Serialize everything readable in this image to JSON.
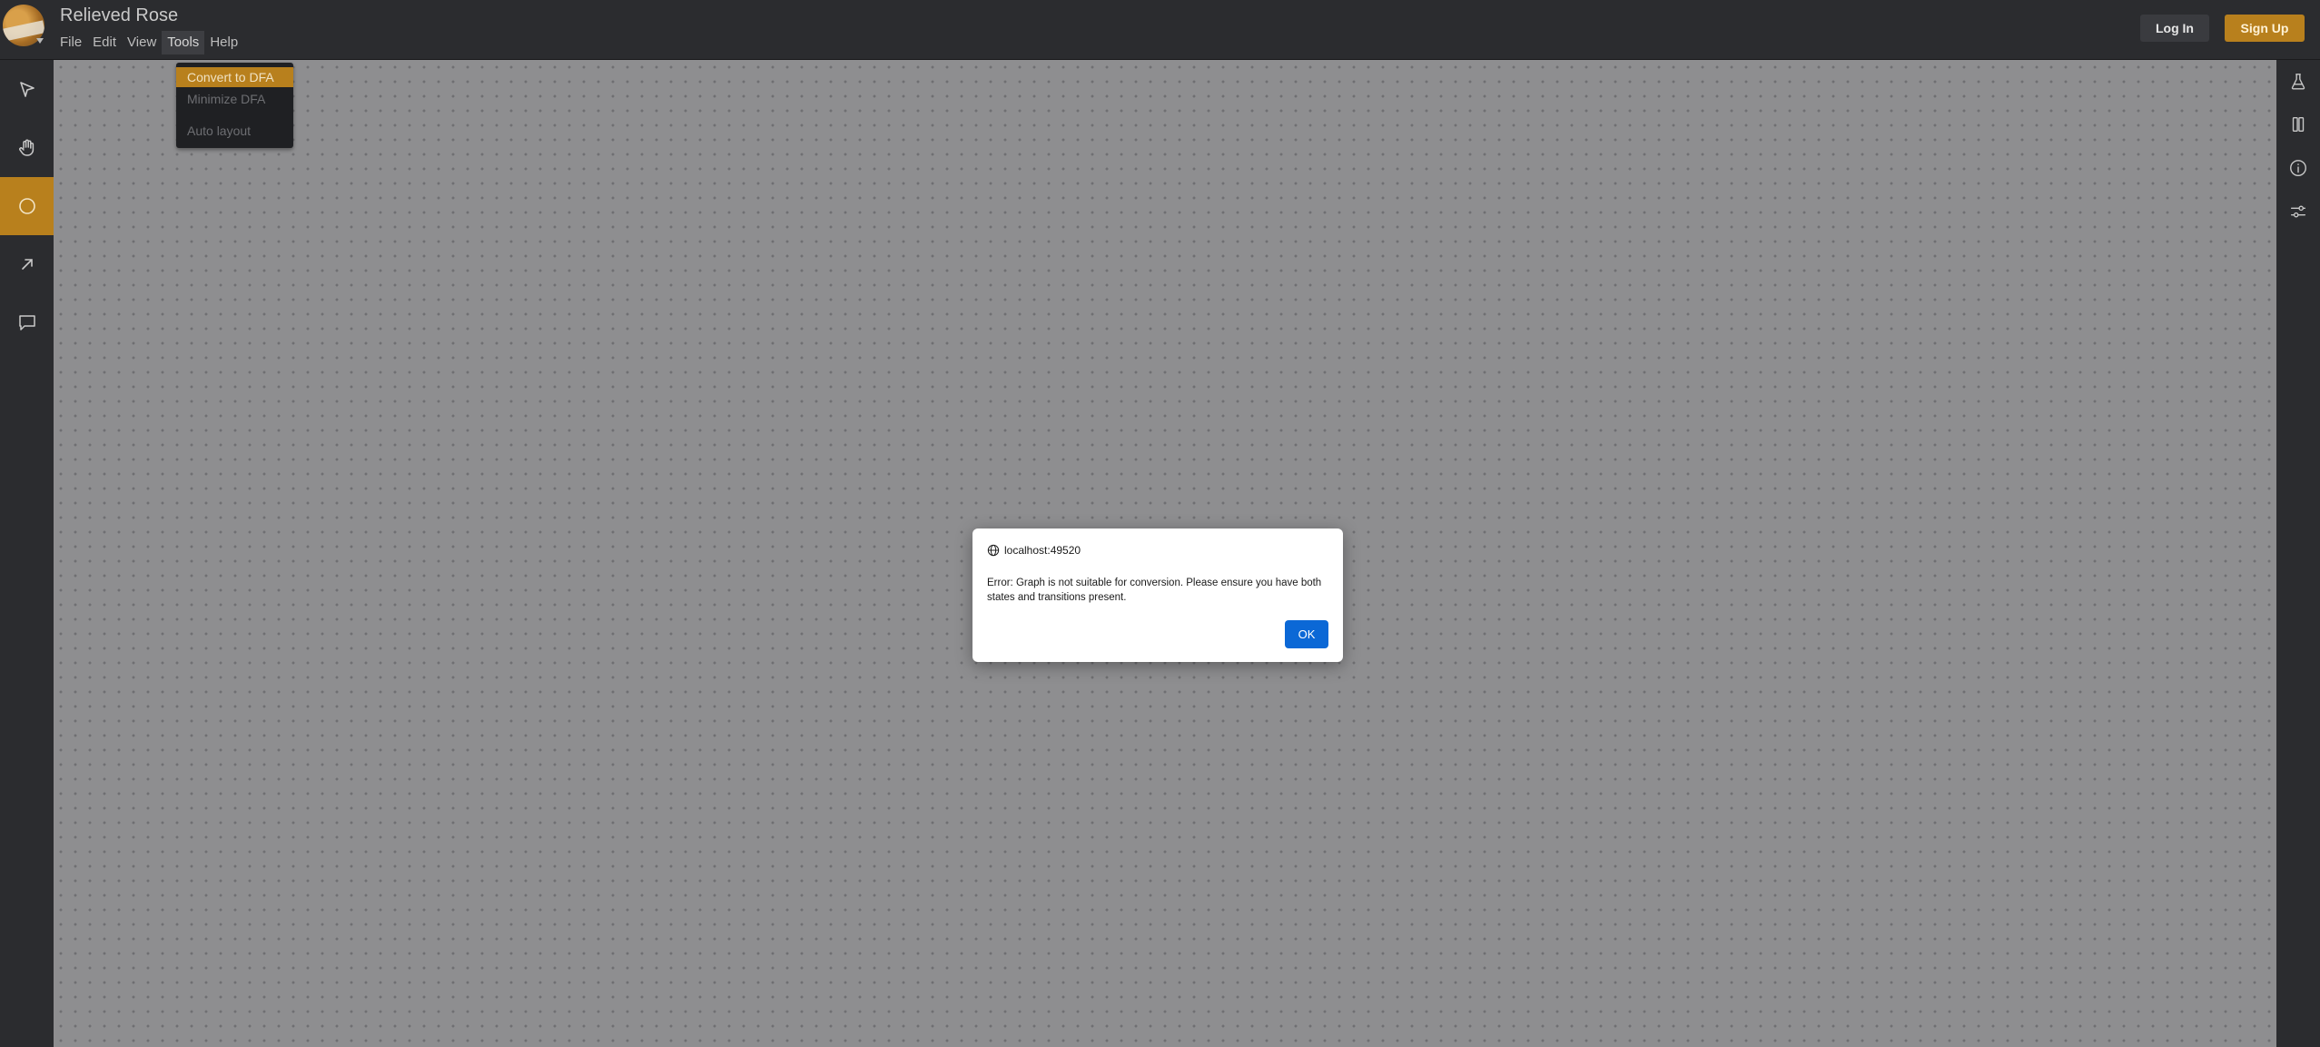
{
  "app": {
    "document_title": "Relieved Rose"
  },
  "menubar": {
    "items": [
      "File",
      "Edit",
      "View",
      "Tools",
      "Help"
    ],
    "active": "Tools"
  },
  "auth": {
    "login_label": "Log In",
    "signup_label": "Sign Up"
  },
  "left_toolbar": {
    "tools": [
      "select-pointer-icon",
      "pan-hand-icon",
      "state-circle-icon",
      "transition-arrow-icon",
      "comment-icon"
    ],
    "active": "state-circle-icon"
  },
  "right_toolbar": {
    "tools": [
      "test-flask-icon",
      "columns-icon",
      "info-icon",
      "settings-sliders-icon"
    ]
  },
  "tools_menu": {
    "items": [
      {
        "label": "Convert to DFA",
        "highlighted": true
      },
      {
        "label": "Minimize DFA",
        "highlighted": false
      },
      {
        "label": "Auto layout",
        "highlighted": false
      }
    ]
  },
  "alert": {
    "origin": "localhost:49520",
    "message": "Error: Graph is not suitable for conversion. Please ensure you have both states and transitions present.",
    "ok_label": "OK"
  },
  "colors": {
    "accent": "#b8801d",
    "canvas": "#8e8e90",
    "chrome": "#2b2c2f",
    "dialog_button": "#0b68d6"
  }
}
